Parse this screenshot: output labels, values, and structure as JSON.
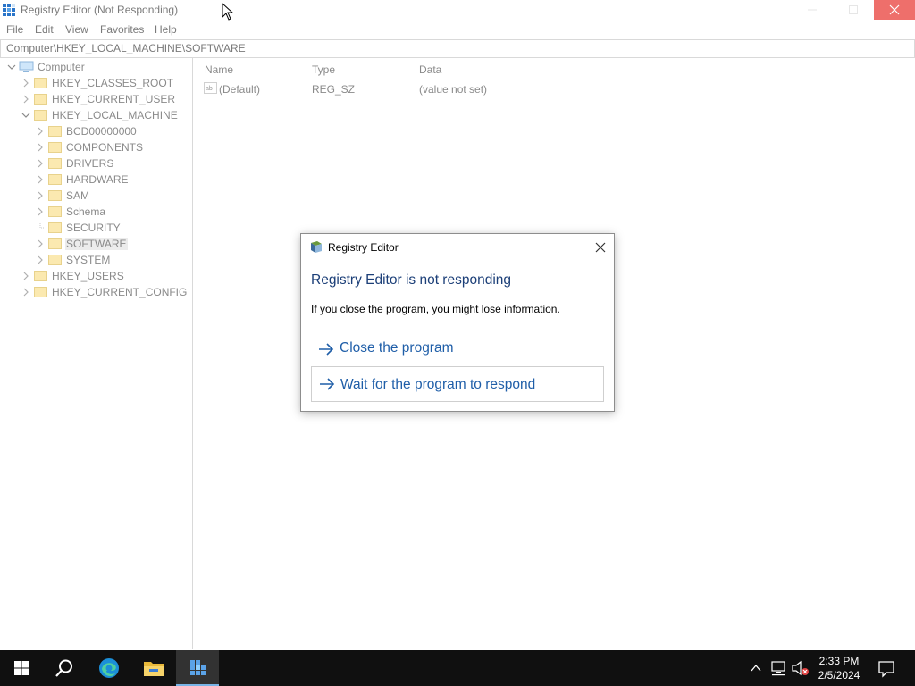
{
  "window": {
    "title": "Registry Editor (Not Responding)"
  },
  "menu": [
    "File",
    "Edit",
    "View",
    "Favorites",
    "Help"
  ],
  "address": "Computer\\HKEY_LOCAL_MACHINE\\SOFTWARE",
  "tree": {
    "root": "Computer",
    "hives": [
      "HKEY_CLASSES_ROOT",
      "HKEY_CURRENT_USER",
      "HKEY_LOCAL_MACHINE",
      "HKEY_USERS",
      "HKEY_CURRENT_CONFIG"
    ],
    "hklm_children": [
      "BCD00000000",
      "COMPONENTS",
      "DRIVERS",
      "HARDWARE",
      "SAM",
      "Schema",
      "SECURITY",
      "SOFTWARE",
      "SYSTEM"
    ],
    "selected": "SOFTWARE"
  },
  "list": {
    "columns": [
      "Name",
      "Type",
      "Data"
    ],
    "rows": [
      {
        "name": "(Default)",
        "type": "REG_SZ",
        "data": "(value not set)",
        "icon": "string-value-icon"
      }
    ]
  },
  "dialog": {
    "title": "Registry Editor",
    "heading": "Registry Editor is not responding",
    "message": "If you close the program, you might lose information.",
    "options": [
      "Close the program",
      "Wait for the program to respond"
    ]
  },
  "taskbar": {
    "time": "2:33 PM",
    "date": "2/5/2024",
    "apps": [
      "start-icon",
      "search-icon",
      "edge-icon",
      "file-explorer-icon",
      "regedit-icon"
    ],
    "tray": [
      "chevron-up-icon",
      "network-icon",
      "volume-muted-icon",
      "notification-icon"
    ]
  },
  "colors": {
    "accent": "#1f5ea8",
    "heading": "#1c3f78",
    "close_button": "#ee6f6b",
    "taskbar": "#101010",
    "active_app_underline": "#78b4e6",
    "folder": "#fbe9b0"
  }
}
